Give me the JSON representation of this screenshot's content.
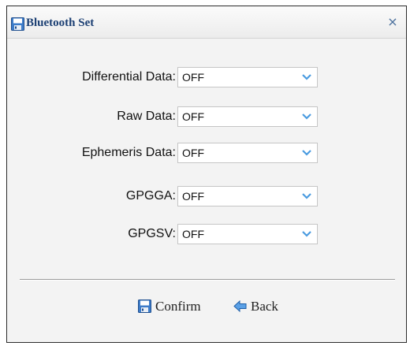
{
  "dialog": {
    "title": "Bluetooth Set",
    "close_label": "×"
  },
  "fields": [
    {
      "label": "Differential Data:",
      "value": "OFF"
    },
    {
      "label": "Raw Data:",
      "value": "OFF"
    },
    {
      "label": "Ephemeris Data:",
      "value": "OFF"
    },
    {
      "label": "GPGGA:",
      "value": "OFF"
    },
    {
      "label": "GPGSV:",
      "value": "OFF"
    }
  ],
  "footer": {
    "confirm_label": "Confirm",
    "back_label": "Back"
  },
  "icons": {
    "title": "save-icon",
    "confirm": "save-icon",
    "back": "back-arrow-icon",
    "dropdown": "chevron-down-icon"
  },
  "colors": {
    "title_text": "#1b3f73",
    "accent_blue": "#3d7cc9",
    "chevron": "#4a9be0"
  }
}
